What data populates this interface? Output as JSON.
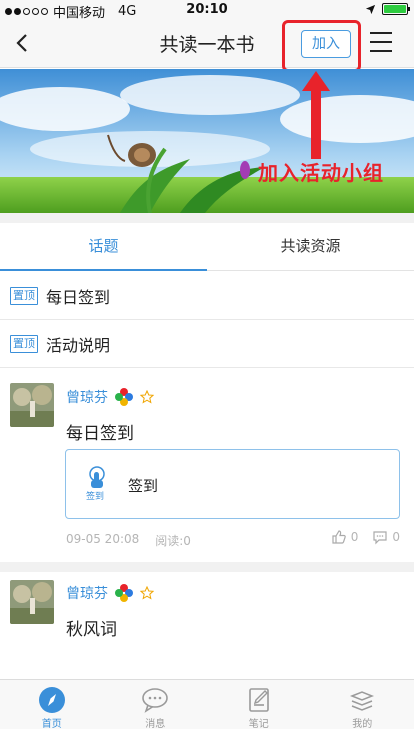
{
  "status_bar": {
    "carrier": "中国移动",
    "network": "4G",
    "time": "20:10",
    "battery_level": 1.0
  },
  "nav": {
    "title": "共读一本书",
    "join_label": "加入",
    "back_icon": "chevron-left-icon",
    "menu_icon": "hamburger-menu-icon"
  },
  "banner": {
    "overlay_label": "加入活动小组"
  },
  "tabs": [
    {
      "label": "话题",
      "active": true
    },
    {
      "label": "共读资源",
      "active": false
    }
  ],
  "pinned": [
    {
      "tag": "置顶",
      "title": "每日签到"
    },
    {
      "tag": "置顶",
      "title": "活动说明"
    }
  ],
  "posts": [
    {
      "author": "曾琼芬",
      "text": "每日签到",
      "card": {
        "icon_label": "签到",
        "label": "签到"
      },
      "date": "09-05 20:08",
      "reads": "阅读:0",
      "likes": "0",
      "comments": "0"
    },
    {
      "author": "曾琼芬",
      "text": "秋风词"
    }
  ],
  "tab_bar": [
    {
      "label": "首页",
      "icon": "compass-icon",
      "active": true
    },
    {
      "label": "消息",
      "icon": "chat-bubble-icon",
      "active": false
    },
    {
      "label": "笔记",
      "icon": "note-edit-icon",
      "active": false
    },
    {
      "label": "我的",
      "icon": "stack-layers-icon",
      "active": false
    }
  ],
  "colors": {
    "accent": "#3a8fd9",
    "highlight_red": "#e8232b"
  }
}
